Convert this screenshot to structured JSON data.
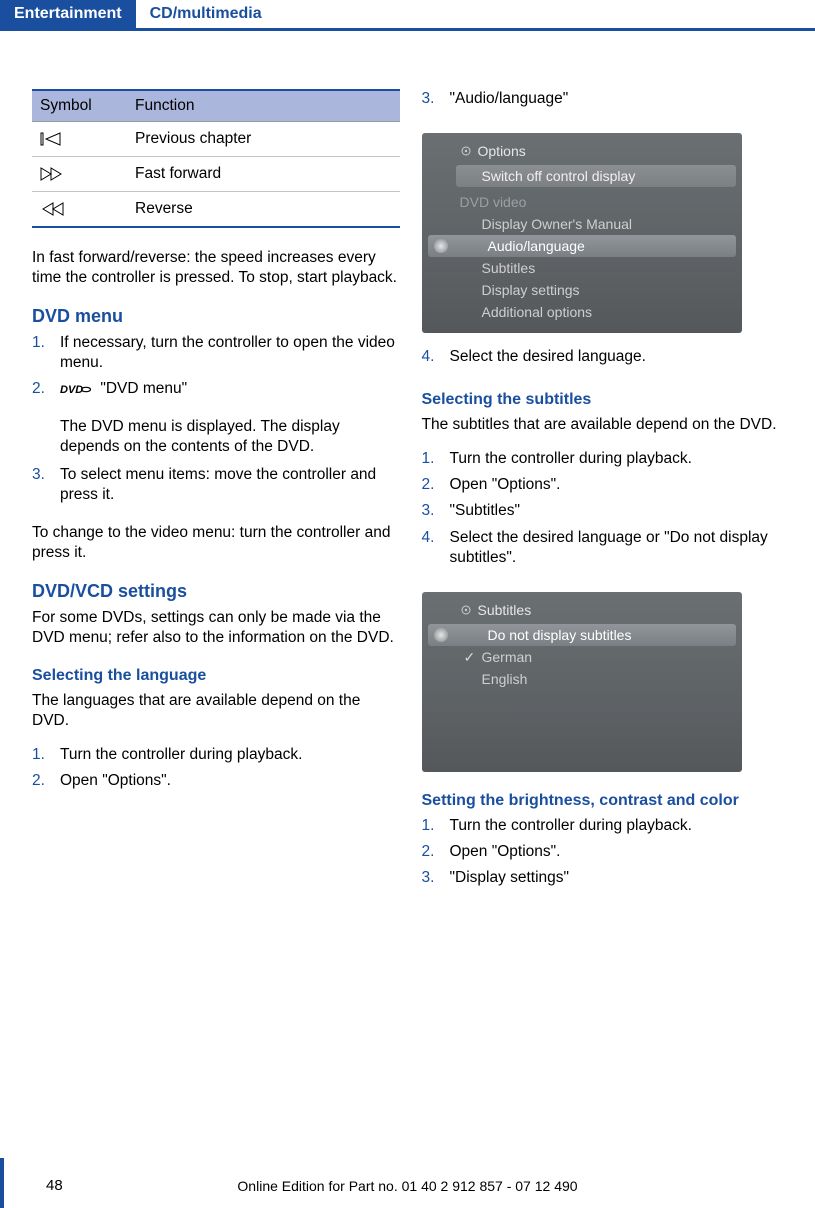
{
  "tabs": {
    "active": "Entertainment",
    "inactive": "CD/multimedia"
  },
  "table": {
    "h1": "Symbol",
    "h2": "Function",
    "r1": "Previous chapter",
    "r2": "Fast forward",
    "r3": "Reverse"
  },
  "left": {
    "p1": "In fast forward/reverse: the speed increases every time the controller is pressed. To stop, start playback.",
    "h_dvdmenu": "DVD menu",
    "dm1": "If necessary, turn the controller to open the video menu.",
    "dm2": "\"DVD menu\"",
    "dm2sub": "The DVD menu is displayed. The display depends on the contents of the DVD.",
    "dm3": "To select menu items: move the controller and press it.",
    "dm_after": "To change to the video menu: turn the controller and press it.",
    "h_dvdvcd": "DVD/VCD settings",
    "p2": "For some DVDs, settings can only be made via the DVD menu; refer also to the information on the DVD.",
    "h_sellang": "Selecting the language",
    "p3": "The languages that are available depend on the DVD.",
    "sl1": "Turn the controller during playback.",
    "sl2": "Open \"Options\"."
  },
  "right": {
    "r3": "\"Audio/language\"",
    "shot1": {
      "title": "Options",
      "row_top": "Switch off control display",
      "sec": "DVD video",
      "row1": "Display Owner's Manual",
      "row_hl": "Audio/language",
      "row2": "Subtitles",
      "row3": "Display settings",
      "row4": "Additional options"
    },
    "r4": "Select the desired language.",
    "h_selsub": "Selecting the subtitles",
    "p4": "The subtitles that are available depend on the DVD.",
    "ss1": "Turn the controller during playback.",
    "ss2": "Open \"Options\".",
    "ss3": "\"Subtitles\"",
    "ss4": "Select the desired language or \"Do not display subtitles\".",
    "shot2": {
      "title": "Subtitles",
      "row_hl": "Do not display subtitles",
      "row1": "German",
      "row2": "English"
    },
    "h_bright": "Setting the brightness, contrast and color",
    "b1": "Turn the controller during playback.",
    "b2": "Open \"Options\".",
    "b3": "\"Display settings\""
  },
  "footer": {
    "page": "48",
    "line": "Online Edition for Part no. 01 40 2 912 857 - 07 12 490"
  }
}
